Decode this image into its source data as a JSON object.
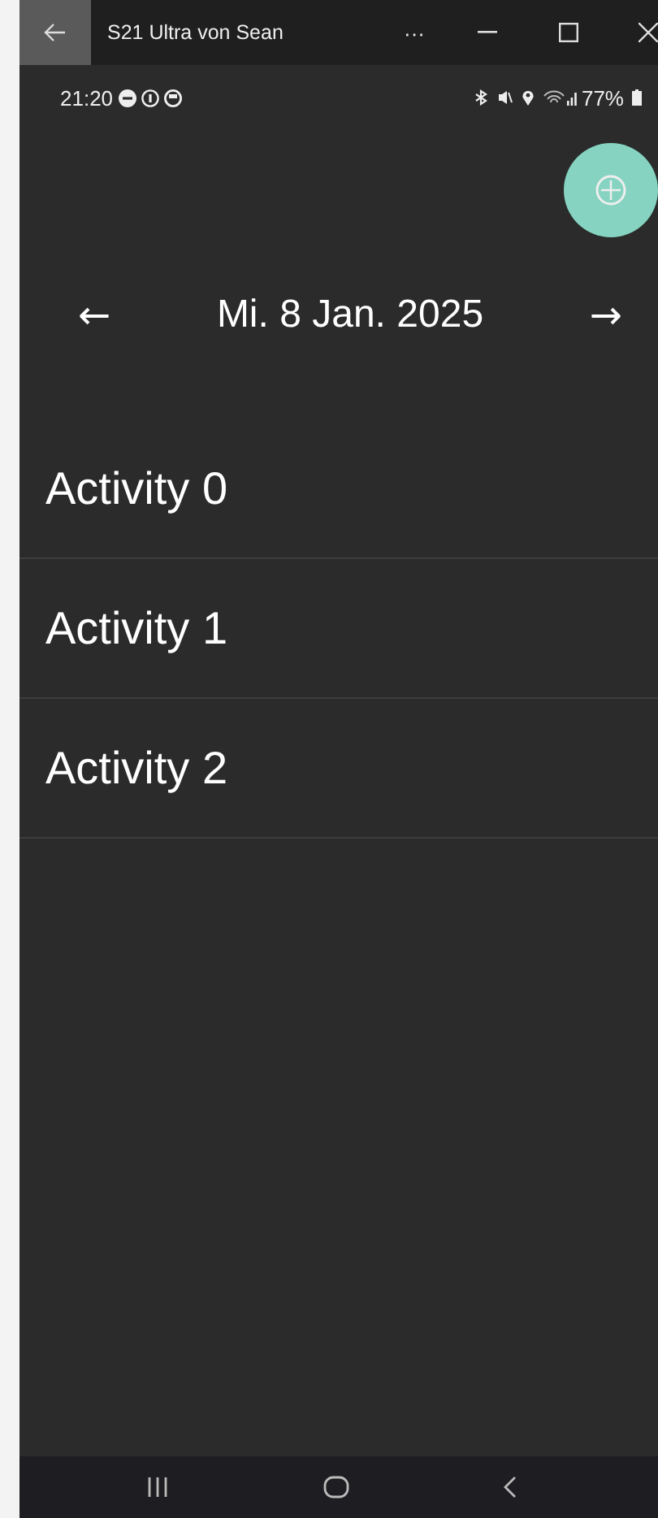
{
  "window": {
    "title": "S21 Ultra von Sean",
    "more": "···"
  },
  "status_bar": {
    "time": "21:20",
    "battery": "77%"
  },
  "date_nav": {
    "prev": "←",
    "date": "Mi. 8 Jan. 2025",
    "next": "→"
  },
  "activities": [
    {
      "name": "Activity 0"
    },
    {
      "name": "Activity 1"
    },
    {
      "name": "Activity 2"
    }
  ]
}
